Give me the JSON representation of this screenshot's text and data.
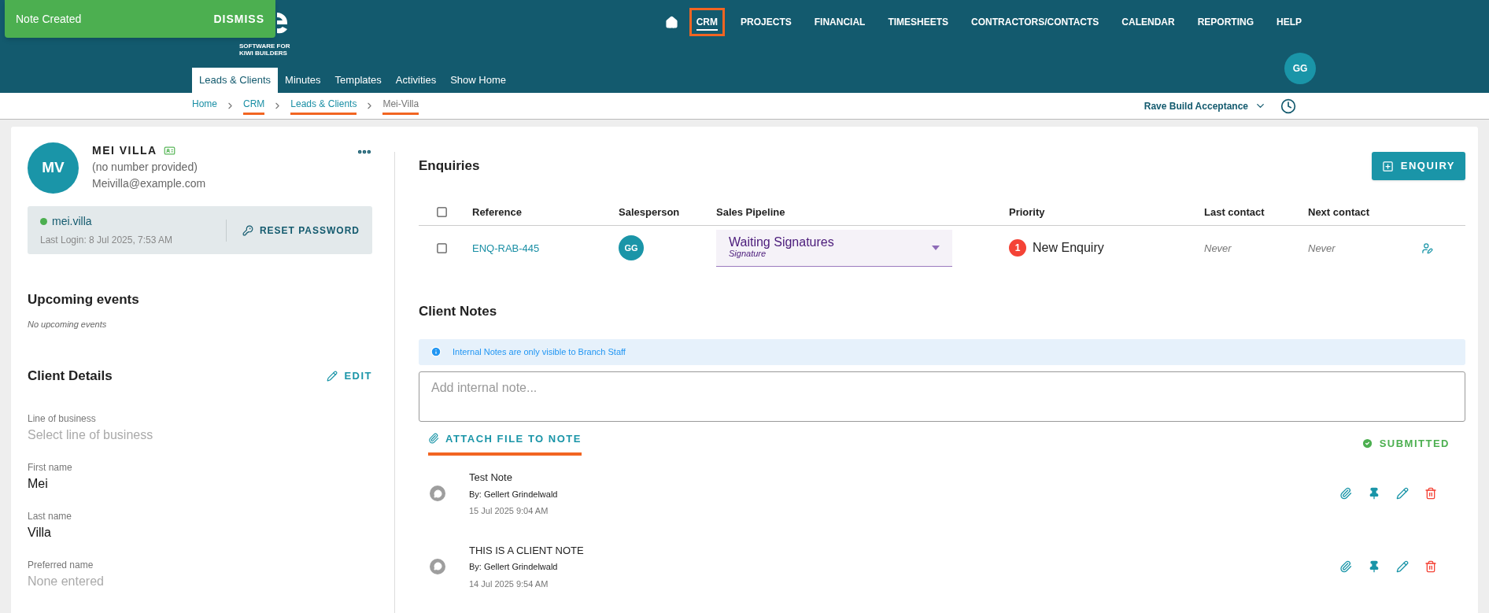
{
  "toast": {
    "message": "Note Created",
    "action": "DISMISS"
  },
  "logo": {
    "tagline": "SOFTWARE FOR KIWI BUILDERS"
  },
  "top_nav": [
    {
      "label": "CRM",
      "selected": true,
      "highlighted": true
    },
    {
      "label": "PROJECTS",
      "selected": false,
      "highlighted": false
    },
    {
      "label": "FINANCIAL",
      "selected": false,
      "highlighted": false
    },
    {
      "label": "TIMESHEETS",
      "selected": false,
      "highlighted": false
    },
    {
      "label": "CONTRACTORS/CONTACTS",
      "selected": false,
      "highlighted": false
    },
    {
      "label": "CALENDAR",
      "selected": false,
      "highlighted": false
    },
    {
      "label": "REPORTING",
      "selected": false,
      "highlighted": false
    },
    {
      "label": "HELP",
      "selected": false,
      "highlighted": false
    }
  ],
  "user_avatar": "GG",
  "tabs": [
    {
      "label": "Leads & Clients",
      "selected": true
    },
    {
      "label": "Minutes",
      "selected": false
    },
    {
      "label": "Templates",
      "selected": false
    },
    {
      "label": "Activities",
      "selected": false
    },
    {
      "label": "Show Home",
      "selected": false
    }
  ],
  "breadcrumb": [
    {
      "label": "Home",
      "current": false,
      "highlighted": false
    },
    {
      "label": "CRM",
      "current": false,
      "highlighted": true
    },
    {
      "label": "Leads & Clients",
      "current": false,
      "highlighted": true
    },
    {
      "label": "Mei-Villa",
      "current": true,
      "highlighted": true
    }
  ],
  "branch_selector": "Rave Build Acceptance",
  "client": {
    "initials": "MV",
    "name": "MEI VILLA",
    "phone": "(no number provided)",
    "email": "Meivilla@example.com",
    "username": "mei.villa",
    "online": true,
    "last_login": "Last Login: 8 Jul 2025, 7:53 AM",
    "reset_button": "RESET PASSWORD"
  },
  "upcoming_events": {
    "title": "Upcoming events",
    "empty_text": "No upcoming events"
  },
  "client_details": {
    "title": "Client Details",
    "edit_button": "EDIT",
    "fields": [
      {
        "label": "Line of business",
        "value": "Select line of business",
        "empty": true
      },
      {
        "label": "First name",
        "value": "Mei",
        "empty": false
      },
      {
        "label": "Last name",
        "value": "Villa",
        "empty": false
      },
      {
        "label": "Preferred name",
        "value": "None entered",
        "empty": true
      }
    ]
  },
  "enquiries": {
    "title": "Enquiries",
    "add_button": "ENQUIRY",
    "columns": [
      "Reference",
      "Salesperson",
      "Sales Pipeline",
      "Priority",
      "Last contact",
      "Next contact"
    ],
    "header_checked": false,
    "rows": [
      {
        "checked": false,
        "reference": "ENQ-RAB-445",
        "salesperson": "GG",
        "pipeline": "Waiting Signatures",
        "pipeline_stage": "Signature",
        "priority_badge": "1",
        "priority": "New Enquiry",
        "last_contact": "Never",
        "next_contact": "Never"
      }
    ]
  },
  "client_notes": {
    "title": "Client Notes",
    "info": "Internal Notes are only visible to Branch Staff",
    "placeholder": "Add internal note...",
    "attach_button": "ATTACH FILE TO NOTE",
    "attach_highlighted": true,
    "status": "SUBMITTED",
    "notes": [
      {
        "title": "Test Note",
        "author": "By: Gellert Grindelwald",
        "date": "15 Jul 2025 9:04 AM"
      },
      {
        "title": "THIS IS A CLIENT NOTE",
        "author": "By: Gellert Grindelwald",
        "date": "14 Jul 2025 9:54 AM"
      }
    ]
  }
}
